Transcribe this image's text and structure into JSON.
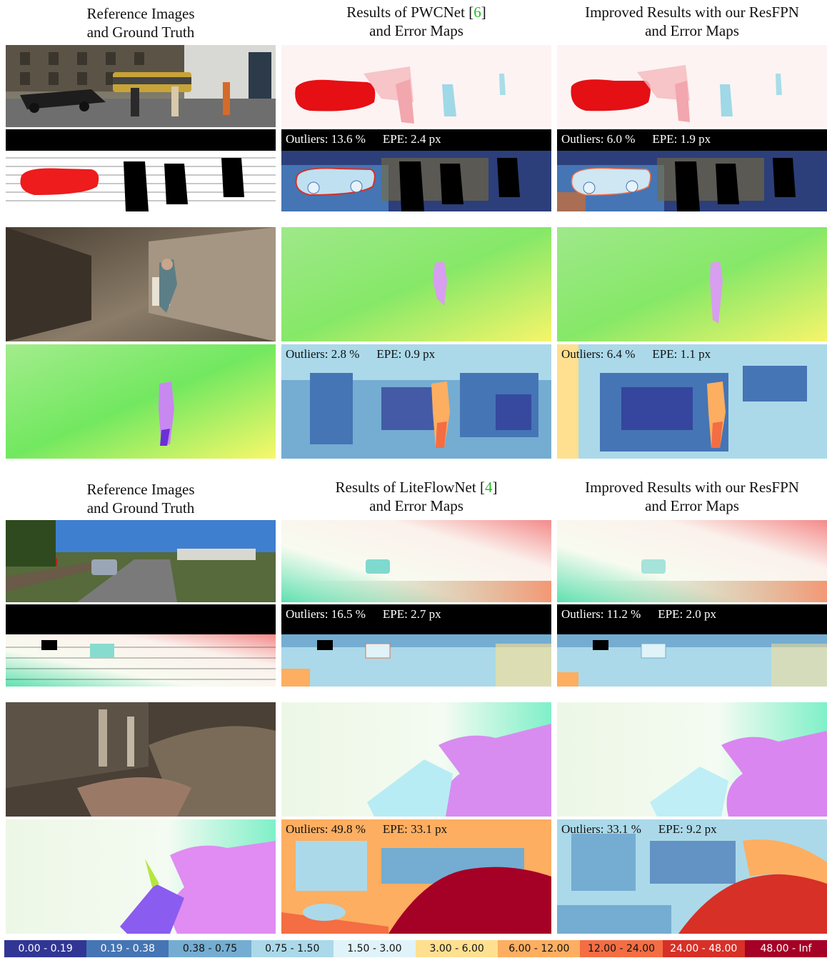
{
  "headers_top": {
    "col1": [
      "Reference Images",
      "and Ground Truth"
    ],
    "col2_line1": "Results of PWCNet [",
    "col2_ref": "6",
    "col2_close": "]",
    "col2_line2": "and Error Maps",
    "col3": [
      "Improved Results with our ResFPN",
      "and Error Maps"
    ]
  },
  "headers_bottom": {
    "col1": [
      "Reference Images",
      "and Ground Truth"
    ],
    "col2_line1": "Results of LiteFlowNet [",
    "col2_ref": "4",
    "col2_close": "]",
    "col2_line2": "and Error Maps",
    "col3": [
      "Improved Results with our ResFPN",
      "and Error Maps"
    ]
  },
  "metrics": {
    "kitti1_pwc": {
      "outliers": "Outliers: 13.6 %",
      "epe": "EPE: 2.4 px"
    },
    "kitti1_res": {
      "outliers": "Outliers: 6.0 %",
      "epe": "EPE: 1.9 px"
    },
    "sintel1_pwc": {
      "outliers": "Outliers: 2.8 %",
      "epe": "EPE: 0.9 px"
    },
    "sintel1_res": {
      "outliers": "Outliers: 6.4 %",
      "epe": "EPE: 1.1 px"
    },
    "kitti2_lfn": {
      "outliers": "Outliers: 16.5 %",
      "epe": "EPE: 2.7 px"
    },
    "kitti2_res": {
      "outliers": "Outliers: 11.2 %",
      "epe": "EPE: 2.0 px"
    },
    "sintel2_lfn": {
      "outliers": "Outliers: 49.8 %",
      "epe": "EPE: 33.1 px"
    },
    "sintel2_res": {
      "outliers": "Outliers: 33.1 %",
      "epe": "EPE: 9.2 px"
    }
  },
  "legend": [
    {
      "label": "0.00 - 0.19",
      "color": "#313695",
      "text": "#ffffff"
    },
    {
      "label": "0.19 - 0.38",
      "color": "#4575b4",
      "text": "#ffffff"
    },
    {
      "label": "0.38 - 0.75",
      "color": "#74add1",
      "text": "#111111"
    },
    {
      "label": "0.75 - 1.50",
      "color": "#abd9e9",
      "text": "#111111"
    },
    {
      "label": "1.50 - 3.00",
      "color": "#e0f3f8",
      "text": "#111111"
    },
    {
      "label": "3.00 - 6.00",
      "color": "#fee090",
      "text": "#111111"
    },
    {
      "label": "6.00 - 12.00",
      "color": "#fdae61",
      "text": "#111111"
    },
    {
      "label": "12.00 - 24.00",
      "color": "#f46d43",
      "text": "#111111"
    },
    {
      "label": "24.00 - 48.00",
      "color": "#d73027",
      "text": "#ffffff"
    },
    {
      "label": "48.00 - Inf",
      "color": "#a50026",
      "text": "#ffffff"
    }
  ]
}
